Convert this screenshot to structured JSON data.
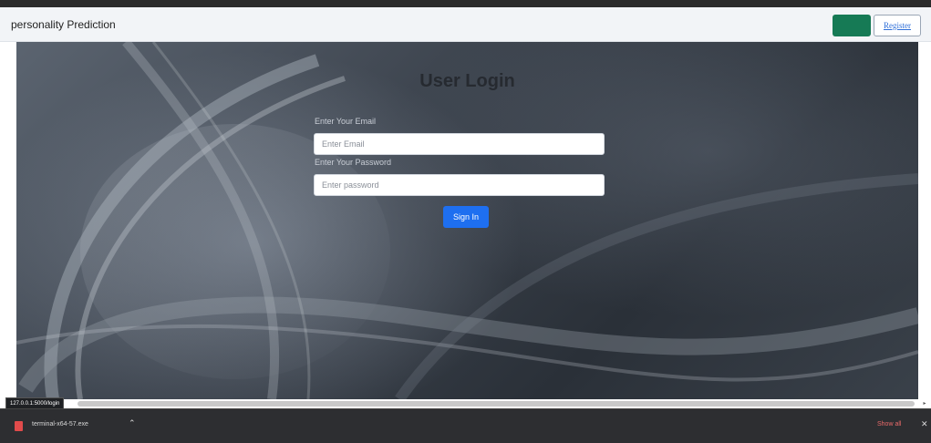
{
  "navbar": {
    "brand": "personality Prediction",
    "register_label": "Register"
  },
  "login": {
    "title": "User Login",
    "email_label": "Enter Your Email",
    "email_placeholder": "Enter Email",
    "password_label": "Enter Your Password",
    "password_placeholder": "Enter password",
    "signin_label": "Sign In"
  },
  "status_bar": {
    "url": "127.0.0.1:5000/login"
  },
  "download_bar": {
    "file_name": "terminal-x64-57.exe",
    "show_all_label": "Show all"
  },
  "colors": {
    "navbar_bg": "#f2f4f7",
    "green_button": "#167a55",
    "primary_button": "#1e6ff0",
    "download_bar_bg": "#2d2e31"
  },
  "icons": {
    "download_file": "pdf-file-icon",
    "download_menu": "chevron-up-icon",
    "download_close": "close-icon",
    "scroll_right": "chevron-right-icon"
  }
}
